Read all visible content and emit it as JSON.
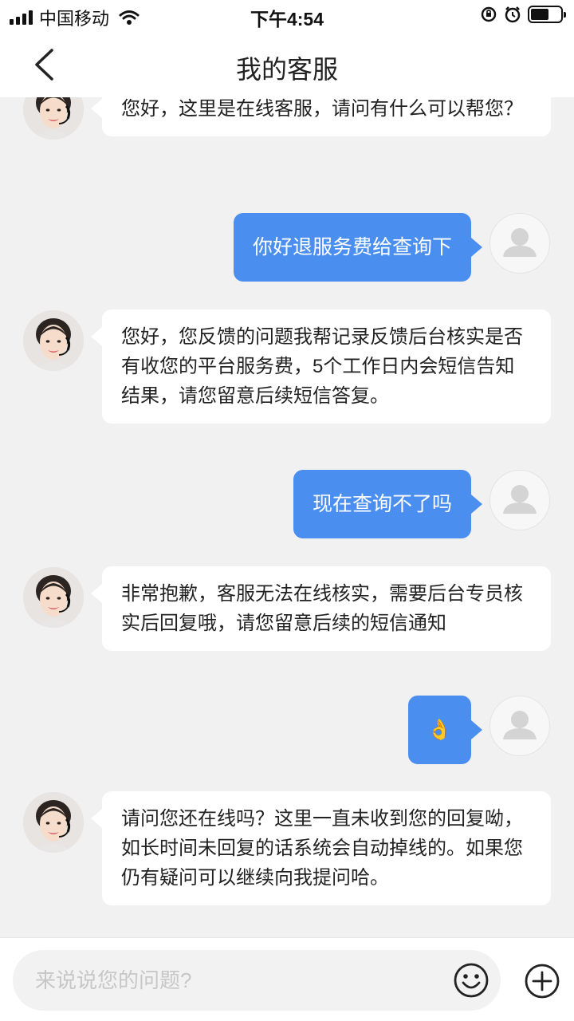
{
  "status_bar": {
    "carrier": "中国移动",
    "time": "下午4:54",
    "icons": [
      "signal-icon",
      "wifi-icon",
      "orientation-lock-icon",
      "alarm-icon",
      "battery-icon"
    ]
  },
  "nav": {
    "back_icon": "chevron-left-icon",
    "title": "我的客服"
  },
  "messages": [
    {
      "sender": "agent",
      "avatar": "agent-avatar",
      "text": "您好，这里是在线客服，请问有什么可以帮您？"
    },
    {
      "sender": "user",
      "avatar": "user-avatar",
      "text": "你好退服务费给查询下"
    },
    {
      "sender": "agent",
      "avatar": "agent-avatar",
      "text": "您好，您反馈的问题我帮记录反馈后台核实是否有收您的平台服务费，5个工作日内会短信告知结果，请您留意后续短信答复。"
    },
    {
      "sender": "user",
      "avatar": "user-avatar",
      "text": "现在查询不了吗"
    },
    {
      "sender": "agent",
      "avatar": "agent-avatar",
      "text": "非常抱歉，客服无法在线核实，需要后台专员核实后回复哦，请您留意后续的短信通知"
    },
    {
      "sender": "user",
      "avatar": "user-avatar",
      "text": "👌"
    },
    {
      "sender": "agent",
      "avatar": "agent-avatar",
      "text": "请问您还在线吗？这里一直未收到您的回复呦，如长时间未回复的话系统会自动掉线的。如果您仍有疑问可以继续向我提问哈。"
    }
  ],
  "input_bar": {
    "placeholder": "来说说您的问题?",
    "value": "",
    "emoji_icon": "smiley-face-icon",
    "plus_icon": "plus-circle-icon"
  },
  "colors": {
    "user_bubble": "#4a8ff0",
    "agent_bubble": "#ffffff",
    "background": "#f1f1f1"
  }
}
